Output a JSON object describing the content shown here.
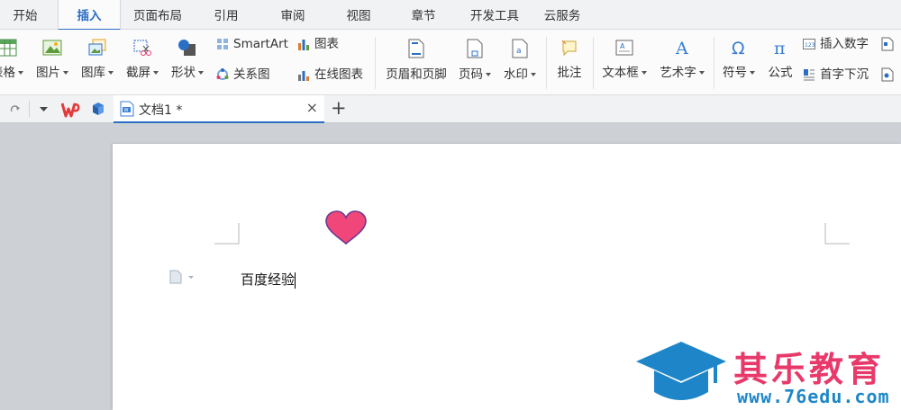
{
  "menu": {
    "tabs": [
      {
        "label": "开始"
      },
      {
        "label": "插入",
        "active": true
      },
      {
        "label": "页面布局"
      },
      {
        "label": "引用"
      },
      {
        "label": "审阅"
      },
      {
        "label": "视图"
      },
      {
        "label": "章节"
      },
      {
        "label": "开发工具"
      },
      {
        "label": "云服务"
      }
    ]
  },
  "ribbon": {
    "table": "表格",
    "picture": "图片",
    "gallery": "图库",
    "screenshot": "截屏",
    "shapes": "形状",
    "smartart": "SmartArt",
    "relation": "关系图",
    "chart": "图表",
    "online_chart": "在线图表",
    "header_footer": "页眉和页脚",
    "page_number": "页码",
    "watermark": "水印",
    "comment": "批注",
    "textbox": "文本框",
    "wordart": "艺术字",
    "symbol": "符号",
    "formula": "公式",
    "insert_number": "插入数字",
    "drop_cap": "首字下沉"
  },
  "tabbar": {
    "doc_title": "文档1 *",
    "close": "×",
    "add": "+"
  },
  "document": {
    "text": "百度经验"
  },
  "watermark": {
    "title": "其乐教育",
    "url": "www.76edu.com"
  },
  "colors": {
    "accent": "#2b6fc4",
    "heart_fill": "#f0467a",
    "heart_stroke": "#6a3b8c",
    "watermark_pink": "#e8396b",
    "watermark_blue": "#1e86c8"
  }
}
